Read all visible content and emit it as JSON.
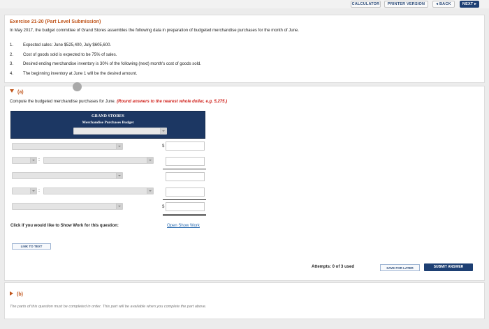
{
  "toolbar": {
    "calculator": "CALCULATOR",
    "printer_version": "PRINTER VERSION",
    "back": "◂ BACK",
    "next": "NEXT ▸"
  },
  "exercise": {
    "title": "Exercise 21-20 (Part Level Submission)",
    "intro": "In May 2017, the budget committee of Grand Stores assembles the following data in preparation of budgeted merchandise purchases for the month of June.",
    "items": [
      {
        "num": "1.",
        "text": "Expected sales: June $525,400, July $605,600."
      },
      {
        "num": "2.",
        "text": "Cost of goods sold is expected to be 75% of sales."
      },
      {
        "num": "3.",
        "text": "Desired ending merchandise inventory is 30% of the following (next) month's cost of goods sold."
      },
      {
        "num": "4.",
        "text": "The beginning inventory at June 1 will be the desired amount."
      }
    ]
  },
  "part_a": {
    "label": "(a)",
    "instruction": "Compute the budgeted merchandise purchases for June.",
    "instruction_note": "(Round answers to the nearest whole dollar, e.g. 5,275.)",
    "budget_title_1": "GRAND STORES",
    "budget_title_2": "Merchandise Purchases Budget",
    "dollar_sign": "$",
    "colon": ":",
    "show_work_label": "Click if you would like to Show Work for this question:",
    "show_work_link": "Open Show Work",
    "link_to_text": "LINK TO TEXT",
    "attempts": "Attempts: 0 of 3 used",
    "save_later": "SAVE FOR LATER",
    "submit": "SUBMIT ANSWER"
  },
  "part_b": {
    "label": "(b)",
    "note": "The parts of this question must be completed in order. This part will be available when you complete the part above."
  },
  "colors": {
    "accent_orange": "#c0561c",
    "navy": "#1d3f73",
    "red_note": "#d0231d",
    "link_blue": "#2b6cb0"
  }
}
